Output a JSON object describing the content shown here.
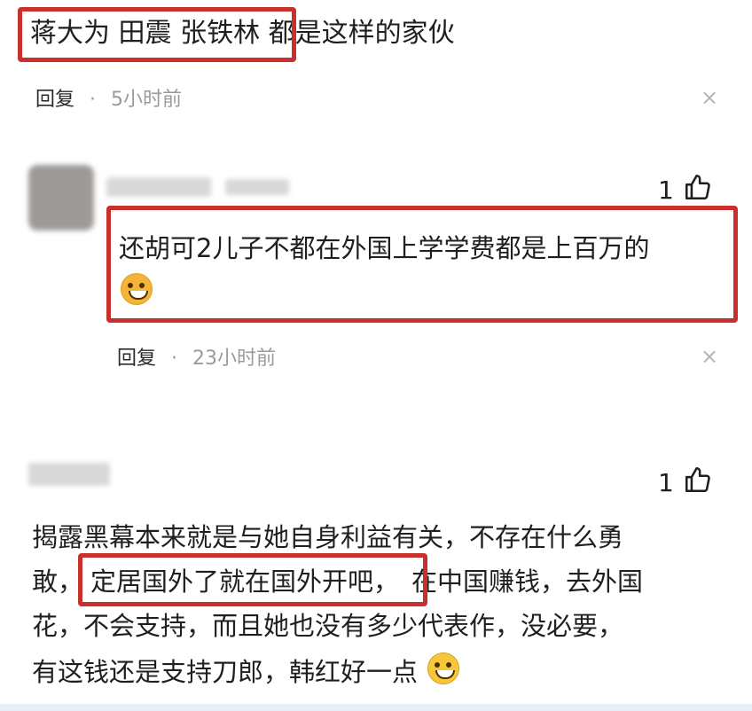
{
  "comment0": {
    "text_highlighted": "蒋大为 田震 张铁林",
    "text_rest": "都是这样的家伙",
    "reply": "回复",
    "dot": "·",
    "time": "5小时前",
    "close": "×"
  },
  "comment1": {
    "likes": "1",
    "text": "还胡可2儿子不都在外国上学学费都是上百万的",
    "emoji": "crying-laughing-emoji",
    "reply": "回复",
    "dot": "·",
    "time": "23小时前",
    "close": "×"
  },
  "comment2": {
    "likes": "1",
    "line1": "揭露黑幕本来就是与她自身利益有关，不存在什么勇",
    "line2_pre": "敢，",
    "line2_hl": "定居国外了就在国外开吧，",
    "line2_post": "在中国赚钱，去外国",
    "line3": "花，不会支持，而且她也没有多少代表作，没必要，",
    "line4": "有这钱还是支持刀郎，韩红好一点",
    "emoji": "grinning-emoji"
  },
  "colors": {
    "highlight": "#c9302c",
    "meta": "#9a9a9a",
    "text": "#1f1f1f"
  }
}
